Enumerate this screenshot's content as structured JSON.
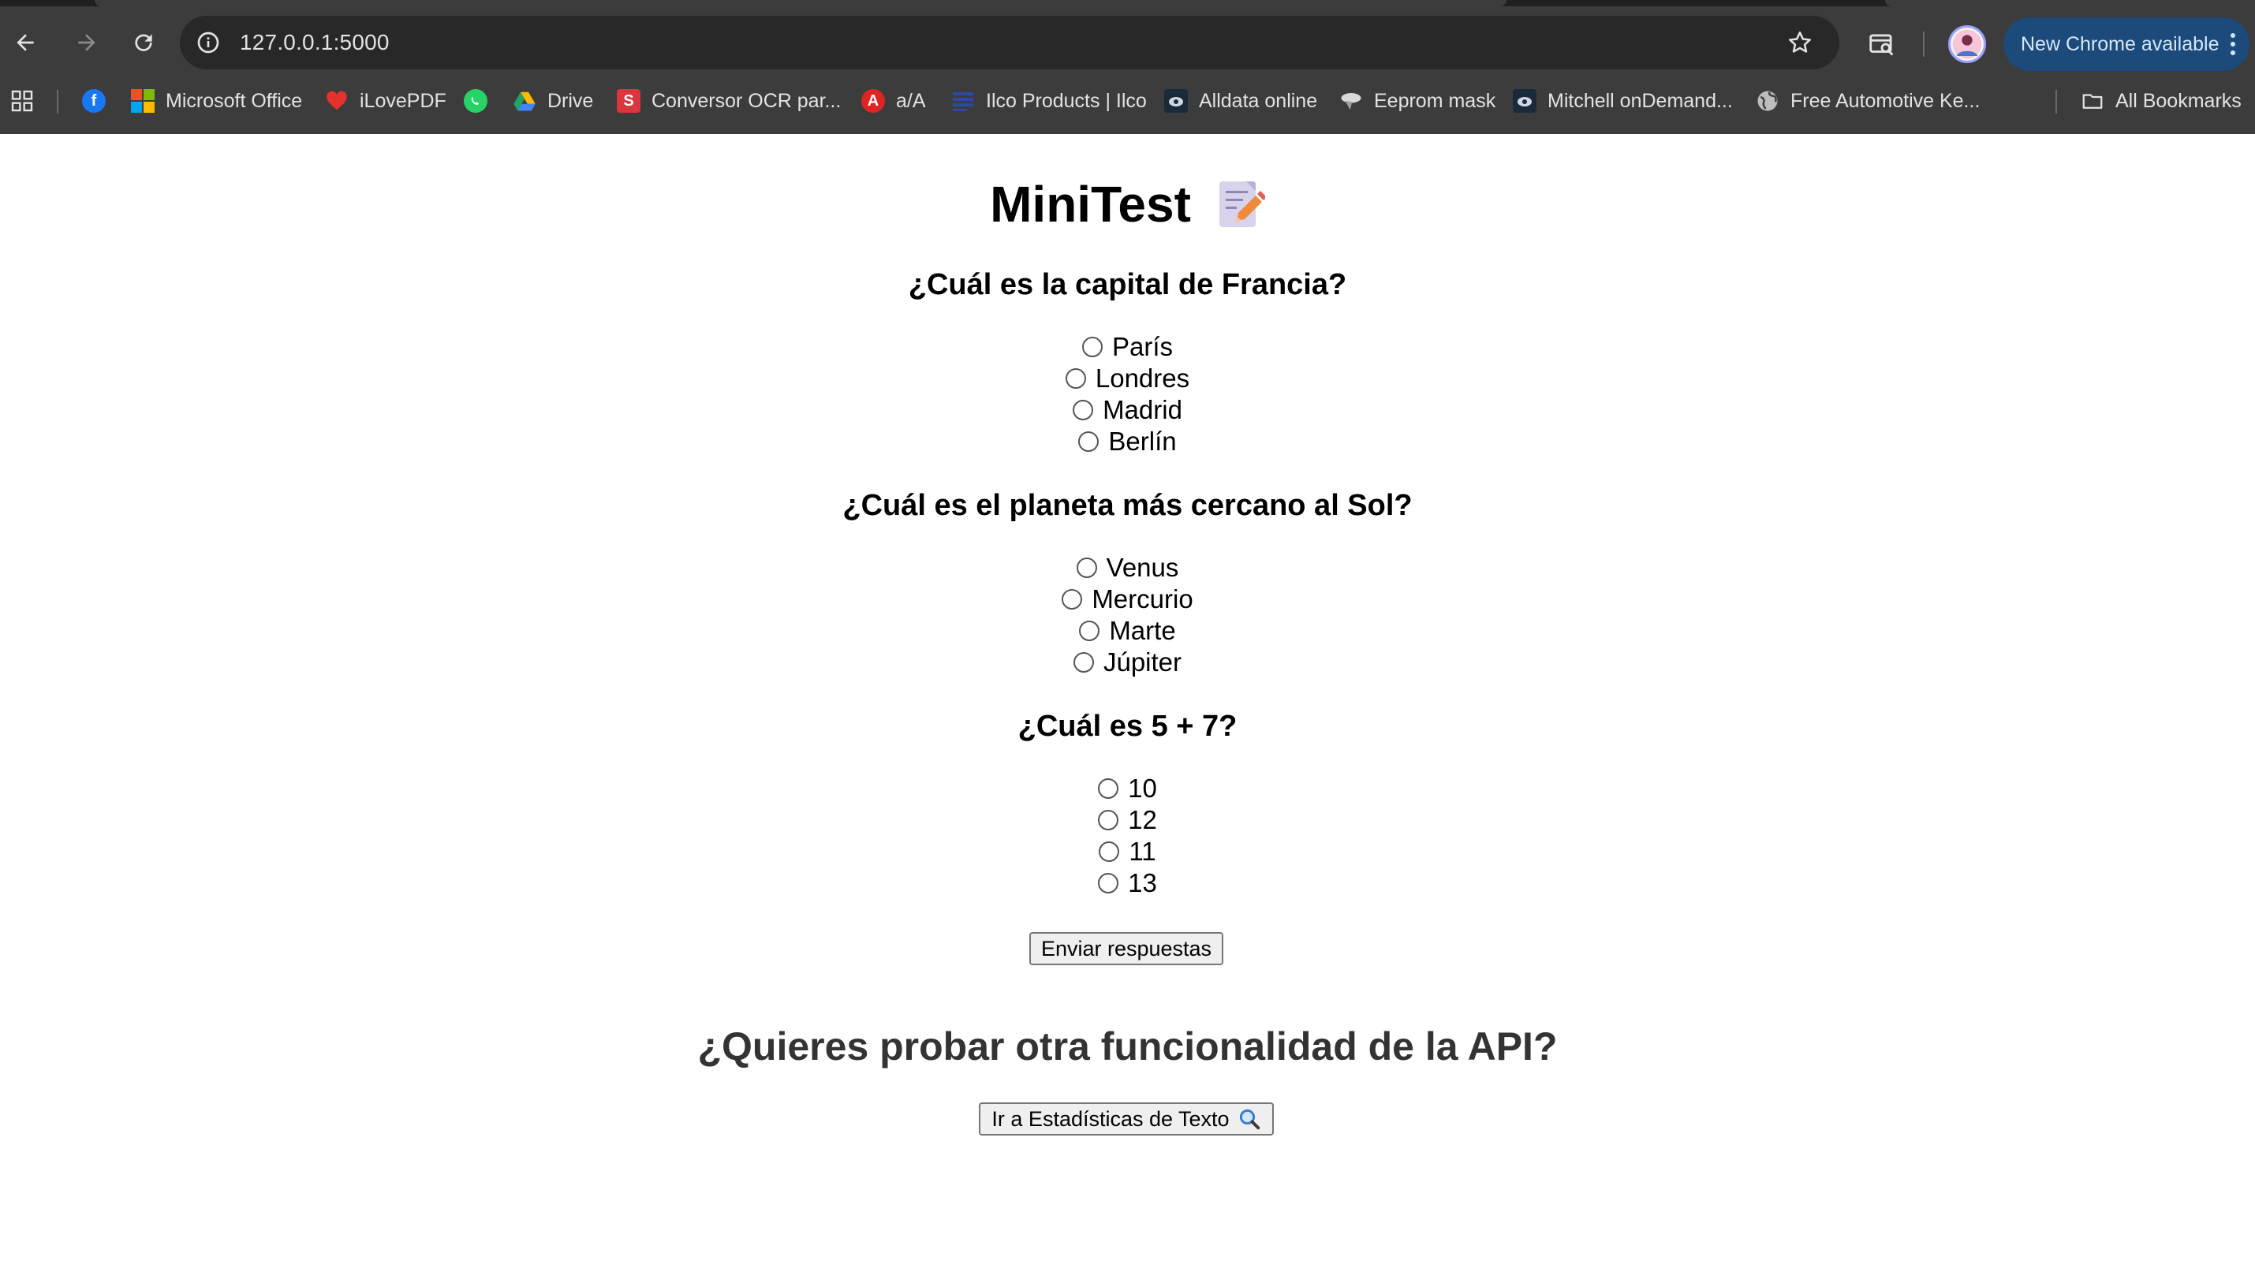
{
  "browser": {
    "url": "127.0.0.1:5000",
    "update_button": "New Chrome available",
    "bookmarks": [
      {
        "label": "",
        "icon": "facebook-icon",
        "color": "#1877f2"
      },
      {
        "label": "Microsoft Office",
        "icon": "microsoft-icon",
        "color": "#f25022"
      },
      {
        "label": "iLovePDF",
        "icon": "heart-icon",
        "color": "#e5322d"
      },
      {
        "label": "",
        "icon": "whatsapp-icon",
        "color": "#25d366"
      },
      {
        "label": "Drive",
        "icon": "drive-icon",
        "color": "#1fa463"
      },
      {
        "label": "Conversor OCR par...",
        "icon": "s-icon",
        "color": "#d9363e"
      },
      {
        "label": "a/A",
        "icon": "a-icon",
        "color": "#e02424"
      },
      {
        "label": "Ilco Products | Ilco",
        "icon": "ilco-icon",
        "color": "#2b4aa0"
      },
      {
        "label": "Alldata online",
        "icon": "alldata-icon",
        "color": "#1b2a3a"
      },
      {
        "label": "Eeprom mask",
        "icon": "chip-icon",
        "color": "#cfcfcf"
      },
      {
        "label": "Mitchell onDemand...",
        "icon": "mitchell-icon",
        "color": "#1b2a3a"
      },
      {
        "label": "Free Automotive Ke...",
        "icon": "globe-icon",
        "color": "#bdbdbd"
      }
    ],
    "all_bookmarks": "All Bookmarks"
  },
  "page": {
    "title": "MiniTest",
    "questions": [
      {
        "text": "¿Cuál es la capital de Francia?",
        "options": [
          "París",
          "Londres",
          "Madrid",
          "Berlín"
        ]
      },
      {
        "text": "¿Cuál es el planeta más cercano al Sol?",
        "options": [
          "Venus",
          "Mercurio",
          "Marte",
          "Júpiter"
        ]
      },
      {
        "text": "¿Cuál es 5 + 7?",
        "options": [
          "10",
          "12",
          "11",
          "13"
        ]
      }
    ],
    "submit_label": "Enviar respuestas",
    "api_heading": "¿Quieres probar otra funcionalidad de la API?",
    "stats_button": "Ir a Estadísticas de Texto"
  }
}
